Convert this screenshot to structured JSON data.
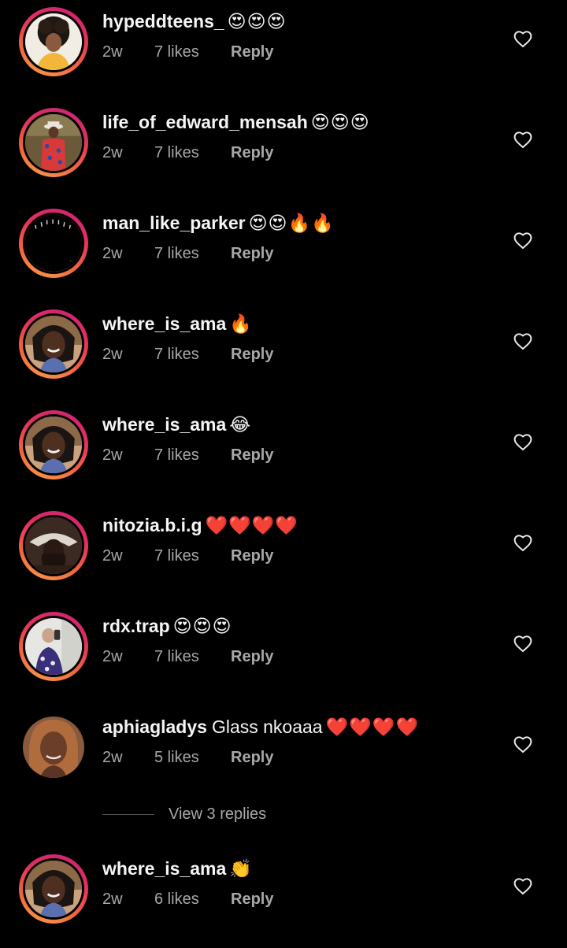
{
  "comments": [
    {
      "username": "hypeddteens_",
      "text": "",
      "emoji": "😍😍😍",
      "time": "2w",
      "likes": "7 likes",
      "reply": "Reply",
      "story_ring": true,
      "avatar": "avatar-hair"
    },
    {
      "username": "life_of_edward_mensah",
      "text": "",
      "emoji": "😍😍😍",
      "time": "2w",
      "likes": "7 likes",
      "reply": "Reply",
      "story_ring": true,
      "avatar": "avatar-suit"
    },
    {
      "username": "man_like_parker",
      "text": "",
      "emoji": "😍😍🔥🔥",
      "time": "2w",
      "likes": "7 likes",
      "reply": "Reply",
      "story_ring": true,
      "avatar": "avatar-dark"
    },
    {
      "username": "where_is_ama",
      "text": "",
      "emoji": "🔥",
      "time": "2w",
      "likes": "7 likes",
      "reply": "Reply",
      "story_ring": true,
      "avatar": "avatar-smile"
    },
    {
      "username": "where_is_ama",
      "text": "",
      "emoji": "😂",
      "time": "2w",
      "likes": "7 likes",
      "reply": "Reply",
      "story_ring": true,
      "avatar": "avatar-smile"
    },
    {
      "username": "nitozia.b.i.g",
      "text": "",
      "emoji": "❤️❤️❤️❤️",
      "time": "2w",
      "likes": "7 likes",
      "reply": "Reply",
      "story_ring": true,
      "avatar": "avatar-headwrap"
    },
    {
      "username": "rdx.trap",
      "text": "",
      "emoji": "😍😍😍",
      "time": "2w",
      "likes": "7 likes",
      "reply": "Reply",
      "story_ring": true,
      "avatar": "avatar-selfie"
    },
    {
      "username": "aphiagladys",
      "text": "Glass nkoaaa",
      "emoji": "❤️❤️❤️❤️",
      "time": "2w",
      "likes": "5 likes",
      "reply": "Reply",
      "story_ring": false,
      "avatar": "avatar-woman"
    },
    {
      "username": "where_is_ama",
      "text": "",
      "emoji": "👏",
      "time": "2w",
      "likes": "6 likes",
      "reply": "Reply",
      "story_ring": true,
      "avatar": "avatar-smile"
    }
  ],
  "view_replies": "View 3 replies",
  "icons": {
    "like": "heart-outline-icon"
  },
  "colors": {
    "background": "#000000",
    "username": "#f5f5f5",
    "meta": "#a8a8a8",
    "ring_start": "#c8207a",
    "ring_end": "#f8a64a"
  }
}
